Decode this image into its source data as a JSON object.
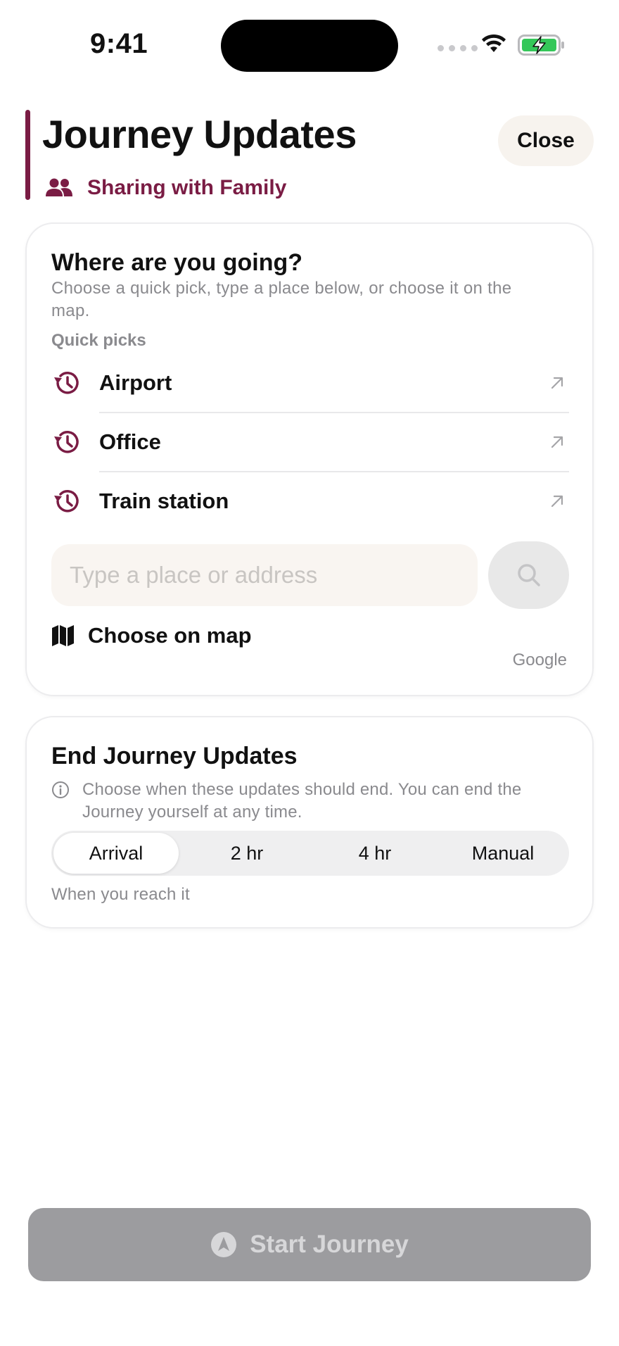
{
  "status_bar": {
    "time": "9:41",
    "icons": [
      "cellular-icon",
      "wifi-icon",
      "battery-charging-icon"
    ]
  },
  "header": {
    "title": "Journey Updates",
    "sharing_label": "Sharing with Family",
    "sharing_icon": "people-icon",
    "close_label": "Close"
  },
  "destination": {
    "title": "Where are you going?",
    "subtitle": "Choose a quick pick, type a place below, or choose it on the map.",
    "quick_picks_label": "Quick picks",
    "quick_picks": [
      {
        "label": "Airport",
        "icon": "history-icon"
      },
      {
        "label": "Office",
        "icon": "history-icon"
      },
      {
        "label": "Train station",
        "icon": "history-icon"
      }
    ],
    "search_placeholder": "Type a place or address",
    "search_value": "",
    "map_label": "Choose on map",
    "map_icon": "map-icon",
    "attribution": "Google"
  },
  "end_updates": {
    "title": "End Journey Updates",
    "info": "Choose when these updates should end. You can end the Journey yourself at any time.",
    "options": [
      "Arrival",
      "2 hr",
      "4 hr",
      "Manual"
    ],
    "selected": "Arrival",
    "hint": "When you reach it"
  },
  "start_button": {
    "label": "Start Journey",
    "icon": "navigation-icon",
    "enabled": false
  },
  "colors": {
    "accent": "#7a1c44",
    "disabled_button": "#9c9c9f",
    "secondary_text": "#8a8a8e"
  }
}
